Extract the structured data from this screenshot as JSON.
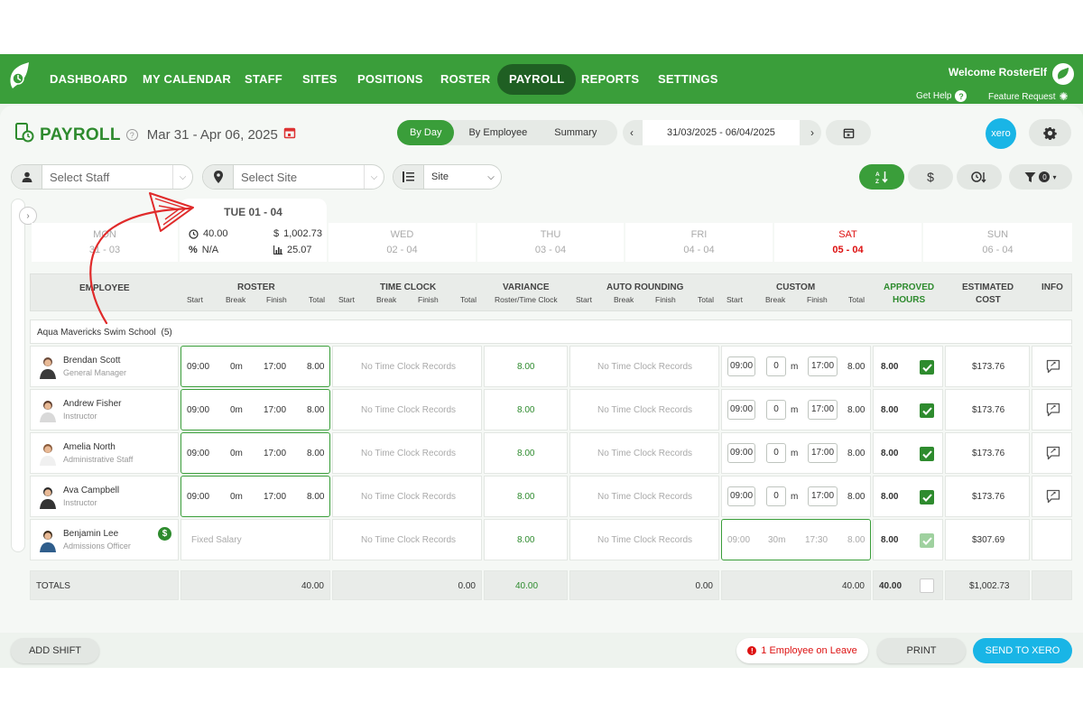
{
  "nav": {
    "items": [
      "DASHBOARD",
      "MY CALENDAR",
      "STAFF",
      "SITES",
      "POSITIONS",
      "ROSTER",
      "PAYROLL",
      "REPORTS",
      "SETTINGS"
    ],
    "active": "PAYROLL",
    "welcome": "Welcome RosterElf",
    "get_help": "Get Help",
    "feature_request": "Feature Request"
  },
  "page": {
    "title": "PAYROLL",
    "date_range": "Mar 31 - Apr 06, 2025"
  },
  "view_tabs": [
    "By Day",
    "By Employee",
    "Summary"
  ],
  "date_nav": {
    "range": "31/03/2025 - 06/04/2025"
  },
  "xero_label": "xero",
  "filters": {
    "staff_placeholder": "Select Staff",
    "site_placeholder": "Select Site",
    "group_by": "Site"
  },
  "filter_badge": "0",
  "days": [
    {
      "name": "MON",
      "date": "31 - 03"
    },
    {
      "name": "TUE",
      "date": "01 - 04"
    },
    {
      "name": "WED",
      "date": "02 - 04"
    },
    {
      "name": "THU",
      "date": "03 - 04"
    },
    {
      "name": "FRI",
      "date": "04 - 04"
    },
    {
      "name": "SAT",
      "date": "05 - 04"
    },
    {
      "name": "SUN",
      "date": "06 - 04"
    }
  ],
  "selected_day": {
    "title": "TUE 01 - 04",
    "hours": "40.00",
    "cost": "1,002.73",
    "percent": "N/A",
    "chart_value": "25.07"
  },
  "columns": {
    "employee": "EMPLOYEE",
    "roster": "ROSTER",
    "time_clock": "TIME CLOCK",
    "variance": "VARIANCE",
    "variance_sub": "Roster/Time Clock",
    "auto_rounding": "AUTO ROUNDING",
    "custom": "CUSTOM",
    "approved_1": "APPROVED",
    "approved_2": "HOURS",
    "estimated_1": "ESTIMATED",
    "estimated_2": "COST",
    "info": "INFO",
    "start": "Start",
    "break": "Break",
    "finish": "Finish",
    "total": "Total"
  },
  "group": {
    "name": "Aqua Mavericks Swim School",
    "count": "(5)"
  },
  "employees": [
    {
      "name": "Brendan Scott",
      "role": "General Manager",
      "r_start": "09:00",
      "r_break": "0m",
      "r_finish": "17:00",
      "r_total": "8.00",
      "time_clock": "No Time Clock Records",
      "variance": "8.00",
      "auto": "No Time Clock Records",
      "c_start": "09:00",
      "c_break": "0",
      "c_unit": "m",
      "c_finish": "17:00",
      "c_total": "8.00",
      "approved": "8.00",
      "cost": "$173.76"
    },
    {
      "name": "Andrew Fisher",
      "role": "Instructor",
      "r_start": "09:00",
      "r_break": "0m",
      "r_finish": "17:00",
      "r_total": "8.00",
      "time_clock": "No Time Clock Records",
      "variance": "8.00",
      "auto": "No Time Clock Records",
      "c_start": "09:00",
      "c_break": "0",
      "c_unit": "m",
      "c_finish": "17:00",
      "c_total": "8.00",
      "approved": "8.00",
      "cost": "$173.76"
    },
    {
      "name": "Amelia North",
      "role": "Administrative Staff",
      "r_start": "09:00",
      "r_break": "0m",
      "r_finish": "17:00",
      "r_total": "8.00",
      "time_clock": "No Time Clock Records",
      "variance": "8.00",
      "auto": "No Time Clock Records",
      "c_start": "09:00",
      "c_break": "0",
      "c_unit": "m",
      "c_finish": "17:00",
      "c_total": "8.00",
      "approved": "8.00",
      "cost": "$173.76"
    },
    {
      "name": "Ava Campbell",
      "role": "Instructor",
      "r_start": "09:00",
      "r_break": "0m",
      "r_finish": "17:00",
      "r_total": "8.00",
      "time_clock": "No Time Clock Records",
      "variance": "8.00",
      "auto": "No Time Clock Records",
      "c_start": "09:00",
      "c_break": "0",
      "c_unit": "m",
      "c_finish": "17:00",
      "c_total": "8.00",
      "approved": "8.00",
      "cost": "$173.76"
    }
  ],
  "salary_employee": {
    "name": "Benjamin Lee",
    "role": "Admissions Officer",
    "salary_badge": "$",
    "roster_text": "Fixed Salary",
    "time_clock": "No Time Clock Records",
    "variance": "8.00",
    "auto": "No Time Clock Records",
    "c_start": "09:00",
    "c_break": "30m",
    "c_finish": "17:30",
    "c_total": "8.00",
    "approved": "8.00",
    "cost": "$307.69"
  },
  "totals": {
    "label": "TOTALS",
    "roster": "40.00",
    "time_clock": "0.00",
    "variance": "40.00",
    "auto": "0.00",
    "custom": "40.00",
    "approved": "40.00",
    "cost": "$1,002.73"
  },
  "bottom": {
    "add_shift": "ADD SHIFT",
    "leave": "1 Employee on Leave",
    "print": "PRINT",
    "send_xero": "SEND TO XERO"
  },
  "colors": {
    "brand": "#3a9e3a",
    "dark": "#1f5f23",
    "xero": "#19b5e6",
    "alert": "#d11"
  }
}
